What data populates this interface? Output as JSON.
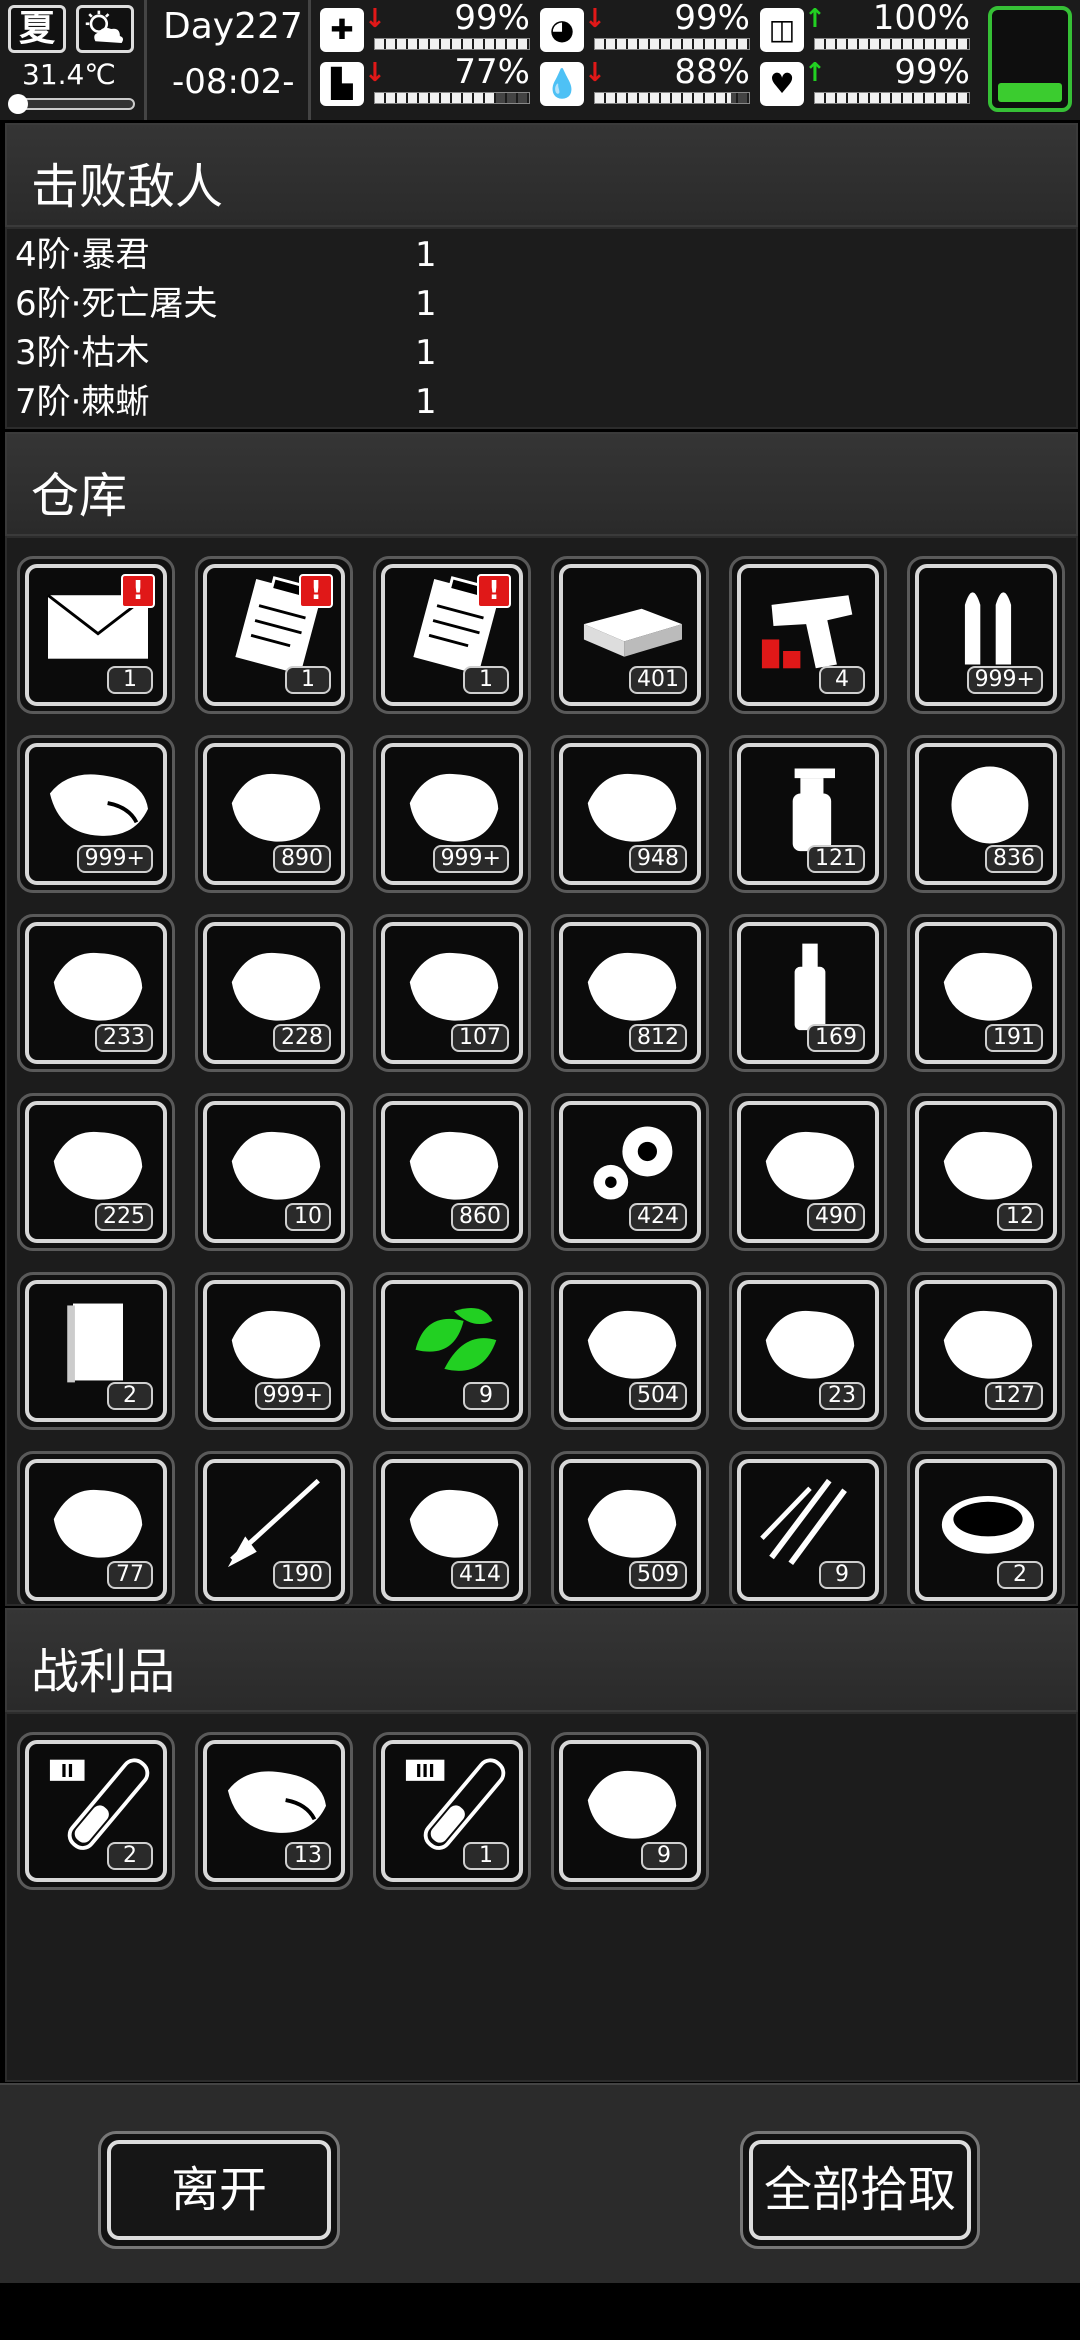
{
  "status": {
    "season": "夏",
    "temperature": "31.4℃",
    "day": "Day227",
    "time": "-08:02-",
    "stats": [
      {
        "name": "health",
        "icon": "health-kit-icon",
        "glyph": "✚",
        "percent": 99,
        "label": "99%",
        "trend": "down"
      },
      {
        "name": "hunger",
        "icon": "stomach-icon",
        "glyph": "◕",
        "percent": 99,
        "label": "99%",
        "trend": "down"
      },
      {
        "name": "medicine",
        "icon": "pill-icon",
        "glyph": "◫",
        "percent": 100,
        "label": "100%",
        "trend": "up"
      },
      {
        "name": "stamina",
        "icon": "boot-icon",
        "glyph": "▙",
        "percent": 77,
        "label": "77%",
        "trend": "down"
      },
      {
        "name": "thirst",
        "icon": "water-drop-icon",
        "glyph": "💧",
        "percent": 88,
        "label": "88%",
        "trend": "down"
      },
      {
        "name": "mood",
        "icon": "heart-icon",
        "glyph": "♥",
        "percent": 99,
        "label": "99%",
        "trend": "up"
      }
    ],
    "battery_level": 0.2,
    "accent_green": "#36c036",
    "alert_red": "#e01818"
  },
  "defeated": {
    "title": "击败敌人",
    "enemies": [
      {
        "name": "4阶·暴君",
        "count": "1"
      },
      {
        "name": "6阶·死亡屠夫",
        "count": "1"
      },
      {
        "name": "3阶·枯木",
        "count": "1"
      },
      {
        "name": "7阶·棘蜥",
        "count": "1"
      }
    ]
  },
  "warehouse": {
    "title": "仓库",
    "items": [
      {
        "icon": "envelope-icon",
        "qty": "1",
        "alert": true
      },
      {
        "icon": "clipboard-icon",
        "qty": "1",
        "alert": true
      },
      {
        "icon": "clipboard-icon",
        "qty": "1",
        "alert": true
      },
      {
        "icon": "cash-stack-icon",
        "qty": "401"
      },
      {
        "icon": "flare-gun-icon",
        "qty": "4"
      },
      {
        "icon": "bullets-icon",
        "qty": "999+"
      },
      {
        "icon": "raw-meat-icon",
        "qty": "999+"
      },
      {
        "icon": "plastic-bottle-scrap-icon",
        "qty": "890"
      },
      {
        "icon": "scrap-metal-icon",
        "qty": "999+"
      },
      {
        "icon": "logs-icon",
        "qty": "948"
      },
      {
        "icon": "spray-bottle-icon",
        "qty": "121"
      },
      {
        "icon": "fiber-ball-icon",
        "qty": "836"
      },
      {
        "icon": "cans-icon",
        "qty": "233"
      },
      {
        "icon": "ear-plugs-icon",
        "qty": "228"
      },
      {
        "icon": "bandage-icon",
        "qty": "107"
      },
      {
        "icon": "wood-plank-icon",
        "qty": "812"
      },
      {
        "icon": "water-bottle-icon",
        "qty": "169"
      },
      {
        "icon": "vegetable-icon",
        "qty": "191"
      },
      {
        "icon": "berries-icon",
        "qty": "225"
      },
      {
        "icon": "seeds-icon",
        "qty": "10"
      },
      {
        "icon": "cloth-icon",
        "qty": "860"
      },
      {
        "icon": "gears-icon",
        "qty": "424"
      },
      {
        "icon": "cotton-balls-icon",
        "qty": "490"
      },
      {
        "icon": "potatoes-icon",
        "qty": "12"
      },
      {
        "icon": "book-icon",
        "qty": "2"
      },
      {
        "icon": "powder-pour-icon",
        "qty": "999+"
      },
      {
        "icon": "green-herb-icon",
        "qty": "9"
      },
      {
        "icon": "gravel-icon",
        "qty": "504"
      },
      {
        "icon": "grain-seeds-icon",
        "qty": "23"
      },
      {
        "icon": "egg-icon",
        "qty": "127"
      },
      {
        "icon": "ice-cubes-icon",
        "qty": "77"
      },
      {
        "icon": "arrow-icon",
        "qty": "190"
      },
      {
        "icon": "folded-towel-icon",
        "qty": "414"
      },
      {
        "icon": "torn-shirt-icon",
        "qty": "509"
      },
      {
        "icon": "claw-marks-icon",
        "qty": "9"
      },
      {
        "icon": "soup-bowl-icon",
        "qty": "2"
      }
    ]
  },
  "loot": {
    "title": "战利品",
    "items": [
      {
        "icon": "test-tube-ii-icon",
        "qty": "2"
      },
      {
        "icon": "raw-meat-icon",
        "qty": "13"
      },
      {
        "icon": "test-tube-iii-icon",
        "qty": "1"
      },
      {
        "icon": "folded-cloth-icon",
        "qty": "9"
      }
    ]
  },
  "buttons": {
    "leave": "离开",
    "take_all": "全部拾取"
  }
}
